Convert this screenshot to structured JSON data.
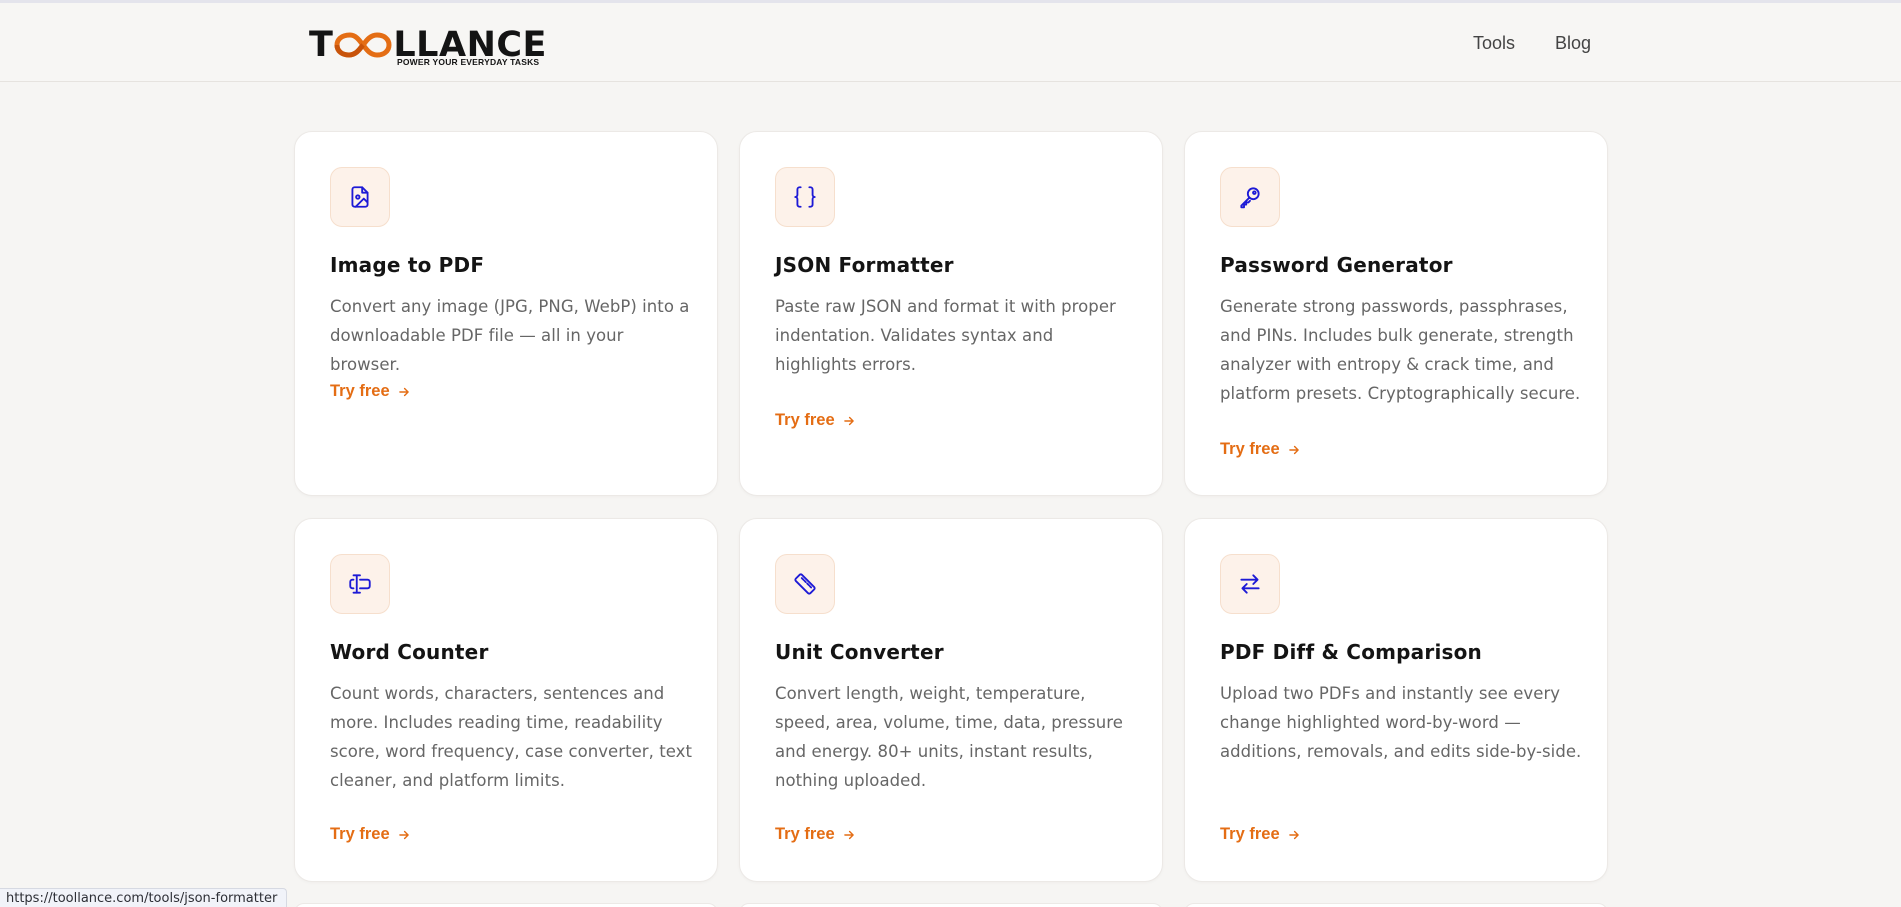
{
  "header": {
    "logo": {
      "prefix": "T",
      "suffix": "LLANCE",
      "tagline": "POWER YOUR EVERYDAY TASKS"
    },
    "nav": [
      {
        "label": "Tools"
      },
      {
        "label": "Blog"
      }
    ]
  },
  "colors": {
    "accent": "#e46d14",
    "icon": "#1d1ad6",
    "icon_bg": "#fdf2ea"
  },
  "cards": [
    {
      "icon": "image-file-icon",
      "title": "Image to PDF",
      "description": "Convert any image (JPG, PNG, WebP) into a downloadable PDF file — all in your browser.",
      "cta": "Try free"
    },
    {
      "icon": "braces-icon",
      "title": "JSON Formatter",
      "description": "Paste raw JSON and format it with proper indentation. Validates syntax and highlights errors.",
      "cta": "Try free"
    },
    {
      "icon": "key-icon",
      "title": "Password Generator",
      "description": "Generate strong passwords, passphrases, and PINs. Includes bulk generate, strength analyzer with entropy & crack time, and platform presets. Cryptographically secure.",
      "cta": "Try free"
    },
    {
      "icon": "text-cursor-icon",
      "title": "Word Counter",
      "description": "Count words, characters, sentences and more. Includes reading time, readability score, word frequency, case converter, text cleaner, and platform limits.",
      "cta": "Try free"
    },
    {
      "icon": "ruler-icon",
      "title": "Unit Converter",
      "description": "Convert length, weight, temperature, speed, area, volume, time, data, pressure and energy. 80+ units, instant results, nothing uploaded.",
      "cta": "Try free"
    },
    {
      "icon": "swap-arrows-icon",
      "title": "PDF Diff & Comparison",
      "description": "Upload two PDFs and instantly see every change highlighted word-by-word — additions, removals, and edits side-by-side.",
      "cta": "Try free"
    }
  ],
  "status_bar": {
    "url": "https://toollance.com/tools/json-formatter"
  }
}
